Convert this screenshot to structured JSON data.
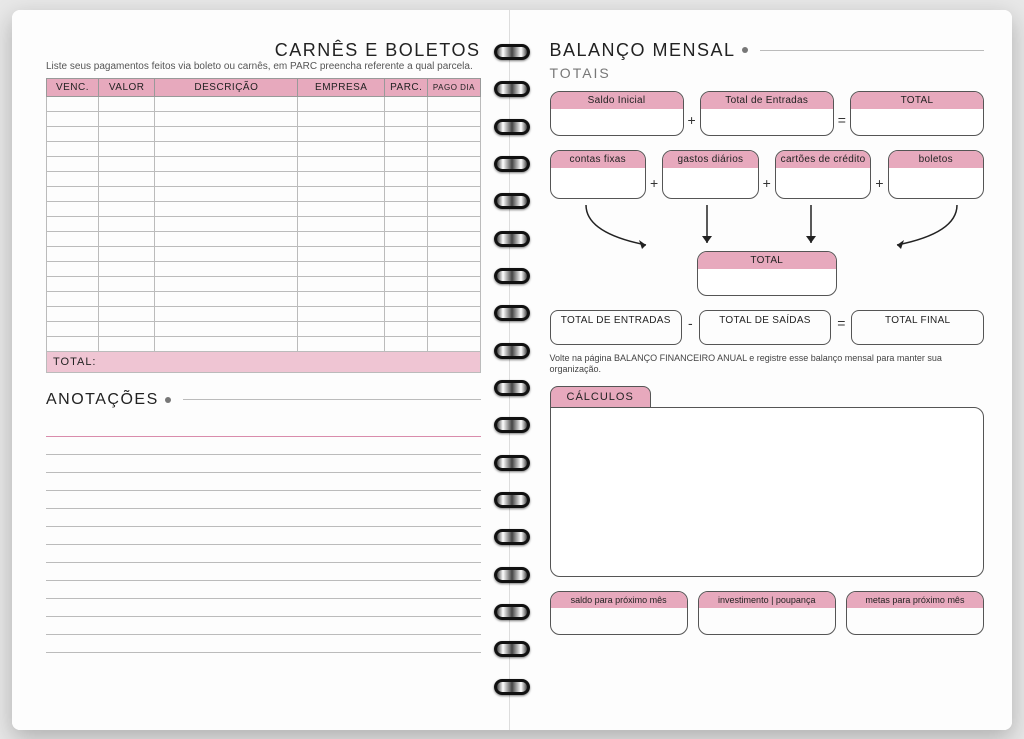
{
  "left": {
    "title": "CARNÊS E BOLETOS",
    "subtitle": "Liste seus pagamentos feitos via boleto ou carnês, em PARC preencha referente a qual parcela.",
    "columns": {
      "venc": "VENC.",
      "valor": "VALOR",
      "descricao": "DESCRIÇÃO",
      "empresa": "EMPRESA",
      "parc": "PARC.",
      "pago_dia": "PAGO DIA"
    },
    "total_label": "TOTAL:",
    "notes_title": "ANOTAÇÕES"
  },
  "right": {
    "title": "BALANÇO MENSAL",
    "subtitle": "TOTAIS",
    "row1": {
      "saldo_inicial": "Saldo Inicial",
      "total_entradas": "Total de Entradas",
      "total": "TOTAL"
    },
    "row2": {
      "contas_fixas": "contas fixas",
      "gastos_diarios": "gastos diários",
      "cartoes": "cartões de crédito",
      "boletos": "boletos"
    },
    "sum_total": "TOTAL",
    "row3": {
      "total_entradas": "TOTAL DE ENTRADAS",
      "total_saidas": "TOTAL DE SAÍDAS",
      "total_final": "TOTAL FINAL"
    },
    "note": "Volte na página BALANÇO FINANCEIRO ANUAL e registre esse balanço mensal para manter sua organização.",
    "calculos": "CÁLCULOS",
    "bottom": {
      "saldo_prox": "saldo para próximo mês",
      "investimento": "investimento | poupança",
      "metas": "metas para próximo mês"
    }
  },
  "ops": {
    "plus": "+",
    "minus": "-",
    "equals": "="
  }
}
